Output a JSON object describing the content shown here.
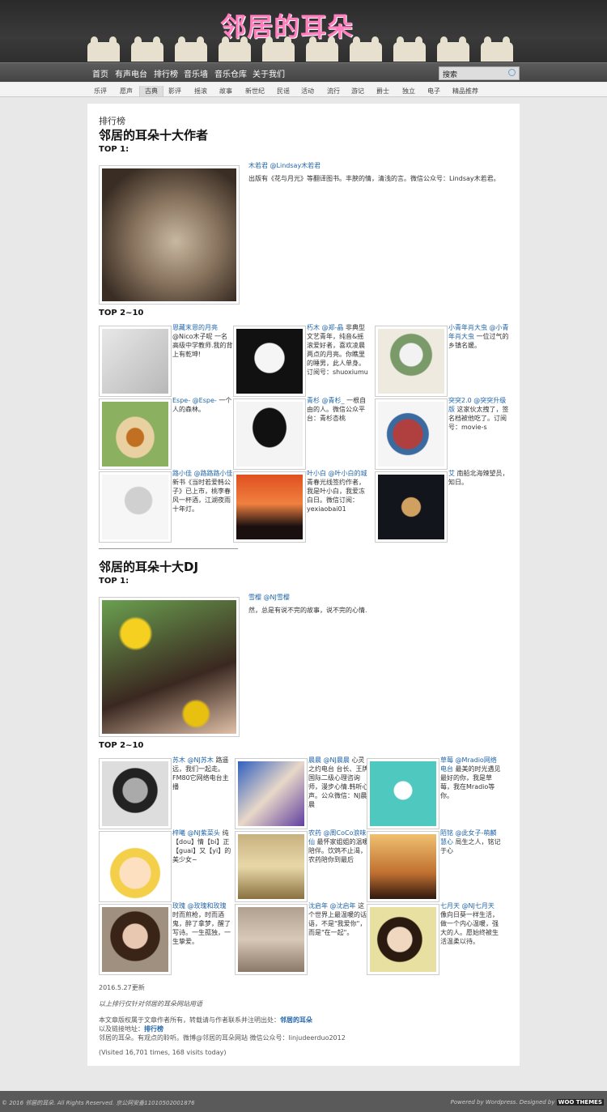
{
  "header": {
    "logo": "邻居的耳朵"
  },
  "nav": {
    "items": [
      "首页",
      "有声电台",
      "排行榜",
      "音乐墙",
      "音乐仓库",
      "关于我们"
    ],
    "search_placeholder": "搜索"
  },
  "subnav": [
    "乐评",
    "愿声",
    "古典",
    "影评",
    "摇滚",
    "故事",
    "新世纪",
    "民谣",
    "活动",
    "流行",
    "游记",
    "爵士",
    "独立",
    "电子",
    "精品推荐"
  ],
  "subnav_active": "古典",
  "page": {
    "breadcrumb": "排行榜",
    "title_authors": "邻居的耳朵十大作者",
    "top1": "TOP 1:",
    "top2_10": "TOP 2~10",
    "title_dj": "邻居的耳朵十大DJ"
  },
  "authors_top1": {
    "name": "木若君 @Lindsay木若君",
    "desc": "出版有《花与月光》等翻译图书。丰腴的情，清浅的言。微信公众号：Lindsay木若君。"
  },
  "authors": [
    {
      "name": "恩藏末恩的月亮",
      "desc": "@Nico木子呢 一名高级中学教师.我的背上有乾坤!"
    },
    {
      "name": "朽木 @郑-晶",
      "desc": "非典型文艺青年，纯音&摇滚爱好者，喜欢凌晨两点的月亮。你瞧里的睡男，此人单身。订阅号：shuoxiumu"
    },
    {
      "name": "小青年肖大虫 @小青年肖大虫",
      "desc": "一位过气的乡镇名媛。"
    },
    {
      "name": "Espe- @Espe- ",
      "desc": "一个人的森林。"
    },
    {
      "name": "青杉 @青杉_",
      "desc": "一根自由的人。微信公众平台：青杉杏桃"
    },
    {
      "name": "突突2.0 @突突升级版",
      "desc": "这家伙太拽了，签名档被他吃了。订阅号：movie-s"
    },
    {
      "name": "路小佳 @路路路小佳",
      "desc": "新书《当时若爱韩公子》已上市，桃李春风一杯酒，江湖夜雨十年灯。"
    },
    {
      "name": "叶小白 @叶小白的城",
      "desc": "青春光线签约作者，我是叶小白，我爱冻白日。微信订阅：yexiaobai01"
    },
    {
      "name": "艾",
      "desc": "南船北海辣望员，知日。"
    }
  ],
  "dj_top1": {
    "name": "雪樱 @NJ雪樱",
    "desc": "然，总是有说不完的故事，说不完的心情."
  },
  "djs": [
    {
      "name": "苏木 @NJ苏木",
      "desc": "路遥远，我们一起走。FM80它网络电台主播"
    },
    {
      "name": "晨晨 @NJ晨晨",
      "desc": "心灵之约电台 台长、王牌国际二级心理咨询师，漫步心情.韩听心声。公众微信：NJ晨晨"
    },
    {
      "name": "草莓 @Mradio网络电台",
      "desc": "最美的时光遇见最好的你，我是草莓，我在Mradio等你。"
    },
    {
      "name": "梓曦 @NJ紫菜头",
      "desc": "纯【dou】情【bi】正【guai】又【yi】的美少女~"
    },
    {
      "name": "农药 @周CoCo浪味仙",
      "desc": "最怀家姐姐的温暖陪伴。饮鸩不止渴，农药陪你到最后"
    },
    {
      "name": "陌铭 @此女子-萌麟慧心",
      "desc": "局生之人，铭记于心"
    },
    {
      "name": "玫瑰 @玫瑰和玫瑰",
      "desc": "时而煎枪，时而酒鬼，醉了拿梦，醒了写诗。一生孤独，一生挚爱。"
    },
    {
      "name": "沈启年 @沈启年",
      "desc": "这个世界上最温暖的话语，不是\"我爱你\"，而是\"在一起\"。"
    },
    {
      "name": "七月天 @NJ七月天",
      "desc": "像向日葵一样生活，做一个内心温暖，强大的人。愿始终被生活温柔以待。"
    }
  ],
  "footer_text": {
    "date": "2016.5.27更新",
    "note": "以上排行仅针对邻居的耳朵网站用语",
    "copy1": "本文章版权属于文章作者所有，转载请与作者联系并注明出处：",
    "copy1_link": "邻居的耳朵",
    "copy2": "以及链接地址：",
    "copy2_link": "排行榜",
    "copy3": "邻居的耳朵。有观点的聆听。微博@邻居的耳朵网站 微信公众号：linjudeerduo2012",
    "visits": "(Visited 16,701 times, 168 visits today)"
  },
  "bottom": {
    "left": "© 2016 邻居的耳朵. All Rights Reserved. 京公网安备11010502001876",
    "right": "Powered by Wordpress. Designed by",
    "brand": "WOO THEMES"
  },
  "colors": {
    "header_bg": "#2e2e2e",
    "logo": "#ff7fbf",
    "link": "#2266aa",
    "page_bg": "#e8e8e8"
  }
}
